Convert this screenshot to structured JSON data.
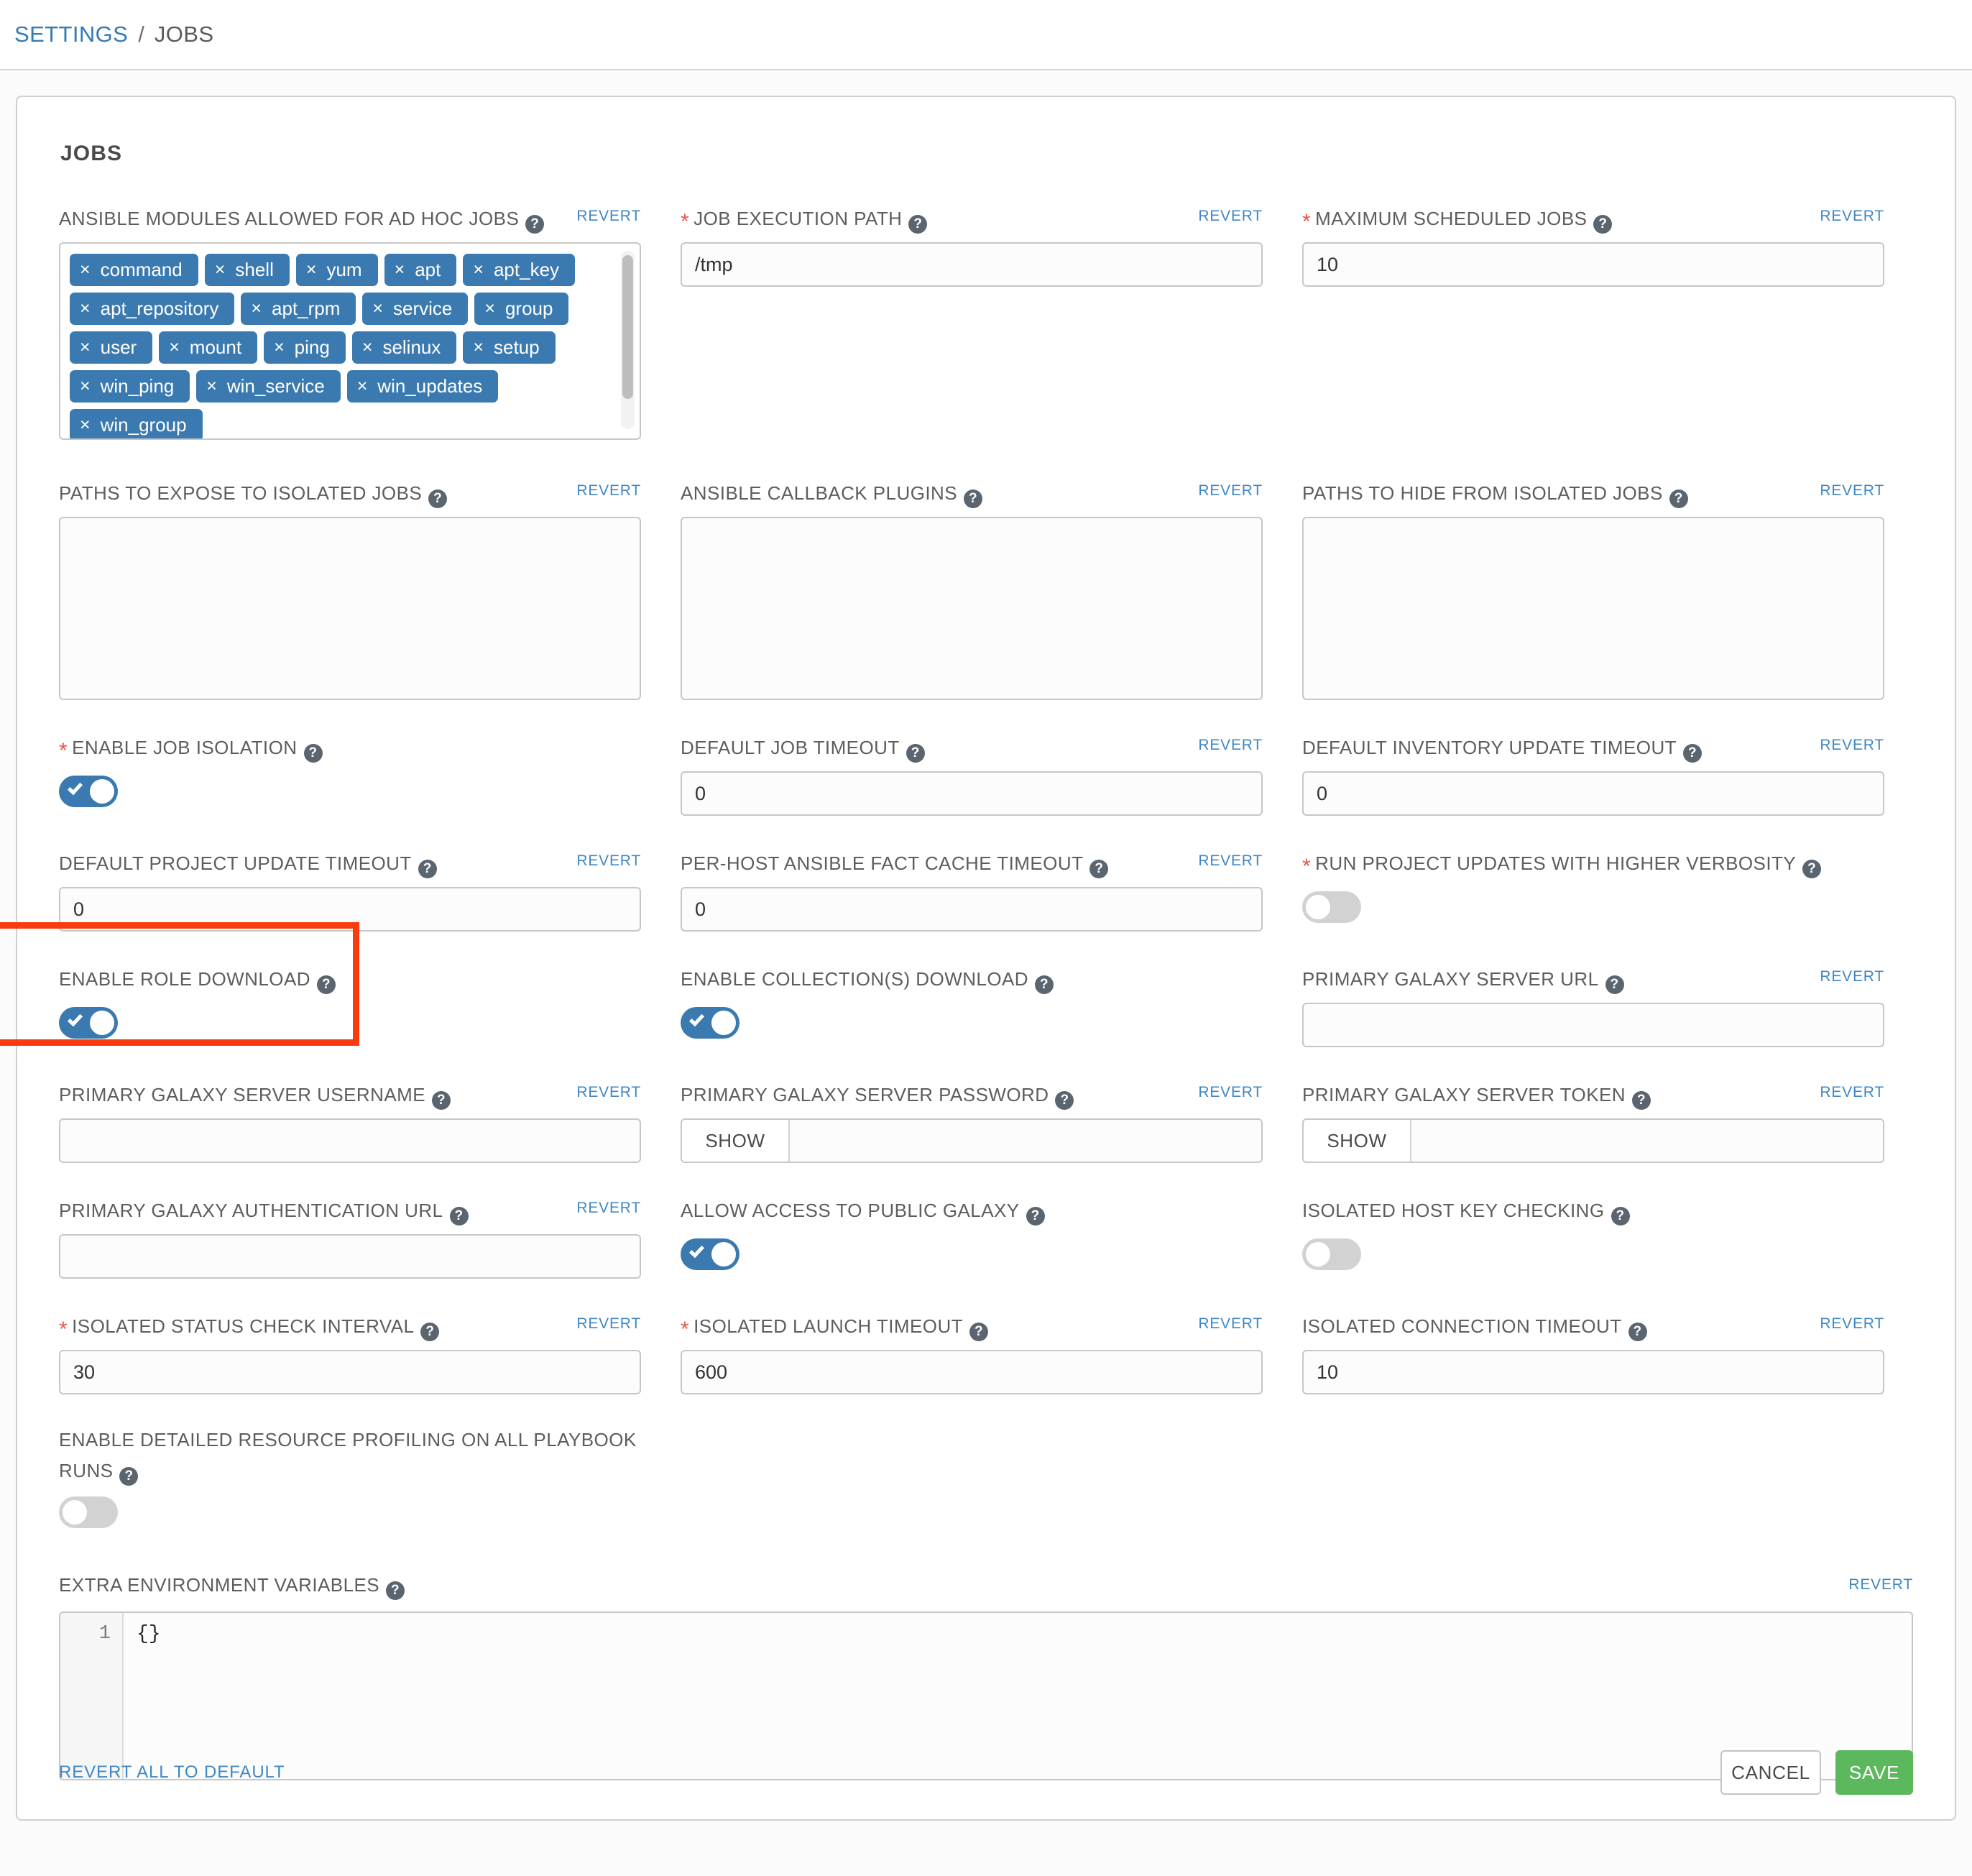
{
  "breadcrumb": {
    "parent": "SETTINGS",
    "separator": "/",
    "current": "JOBS"
  },
  "card": {
    "title": "JOBS"
  },
  "common": {
    "revert": "REVERT",
    "help": "?",
    "required_mark": "*",
    "show": "SHOW"
  },
  "fields": {
    "ansible_modules": {
      "label": "ANSIBLE MODULES ALLOWED FOR AD HOC JOBS",
      "revert": "REVERT",
      "tags": [
        "command",
        "shell",
        "yum",
        "apt",
        "apt_key",
        "apt_repository",
        "apt_rpm",
        "service",
        "group",
        "user",
        "mount",
        "ping",
        "selinux",
        "setup",
        "win_ping",
        "win_service",
        "win_updates",
        "win_group"
      ]
    },
    "job_execution_path": {
      "label": "JOB EXECUTION PATH",
      "revert": "REVERT",
      "value": "/tmp",
      "required": true
    },
    "maximum_scheduled_jobs": {
      "label": "MAXIMUM SCHEDULED JOBS",
      "revert": "REVERT",
      "value": "10",
      "required": true
    },
    "paths_expose": {
      "label": "PATHS TO EXPOSE TO ISOLATED JOBS",
      "revert": "REVERT",
      "value": ""
    },
    "callback_plugins": {
      "label": "ANSIBLE CALLBACK PLUGINS",
      "revert": "REVERT",
      "value": ""
    },
    "paths_hide": {
      "label": "PATHS TO HIDE FROM ISOLATED JOBS",
      "revert": "REVERT",
      "value": ""
    },
    "enable_job_isolation": {
      "label": "ENABLE JOB ISOLATION",
      "required": true,
      "state": "on"
    },
    "default_job_timeout": {
      "label": "DEFAULT JOB TIMEOUT",
      "revert": "REVERT",
      "value": "0"
    },
    "default_inventory_update_timeout": {
      "label": "DEFAULT INVENTORY UPDATE TIMEOUT",
      "revert": "REVERT",
      "value": "0"
    },
    "default_project_update_timeout": {
      "label": "DEFAULT PROJECT UPDATE TIMEOUT",
      "revert": "REVERT",
      "value": "0"
    },
    "per_host_fact_cache_timeout": {
      "label": "PER-HOST ANSIBLE FACT CACHE TIMEOUT",
      "revert": "REVERT",
      "value": "0"
    },
    "run_project_updates_verbosity": {
      "label": "RUN PROJECT UPDATES WITH HIGHER VERBOSITY",
      "required": true,
      "state": "off"
    },
    "enable_role_download": {
      "label": "ENABLE ROLE DOWNLOAD",
      "state": "on",
      "highlighted": true
    },
    "enable_collections_download": {
      "label": "ENABLE COLLECTION(S) DOWNLOAD",
      "state": "on"
    },
    "primary_galaxy_server_url": {
      "label": "PRIMARY GALAXY SERVER URL",
      "revert": "REVERT",
      "value": ""
    },
    "primary_galaxy_username": {
      "label": "PRIMARY GALAXY SERVER USERNAME",
      "revert": "REVERT",
      "value": ""
    },
    "primary_galaxy_password": {
      "label": "PRIMARY GALAXY SERVER PASSWORD",
      "revert": "REVERT",
      "value": "",
      "show": "SHOW"
    },
    "primary_galaxy_token": {
      "label": "PRIMARY GALAXY SERVER TOKEN",
      "revert": "REVERT",
      "value": "",
      "show": "SHOW"
    },
    "primary_galaxy_auth_url": {
      "label": "PRIMARY GALAXY AUTHENTICATION URL",
      "revert": "REVERT",
      "value": ""
    },
    "allow_public_galaxy": {
      "label": "ALLOW ACCESS TO PUBLIC GALAXY",
      "state": "on"
    },
    "isolated_host_key_checking": {
      "label": "ISOLATED HOST KEY CHECKING",
      "state": "off"
    },
    "isolated_status_check_interval": {
      "label": "ISOLATED STATUS CHECK INTERVAL",
      "revert": "REVERT",
      "value": "30",
      "required": true
    },
    "isolated_launch_timeout": {
      "label": "ISOLATED LAUNCH TIMEOUT",
      "revert": "REVERT",
      "value": "600",
      "required": true
    },
    "isolated_connection_timeout": {
      "label": "ISOLATED CONNECTION TIMEOUT",
      "revert": "REVERT",
      "value": "10"
    },
    "detailed_resource_profiling": {
      "label": "ENABLE DETAILED RESOURCE PROFILING ON ALL PLAYBOOK RUNS",
      "state": "off"
    },
    "extra_environment_variables": {
      "label": "EXTRA ENVIRONMENT VARIABLES",
      "revert": "REVERT",
      "line_number": "1",
      "value": "{}"
    }
  },
  "footer": {
    "revert_all": "REVERT ALL TO DEFAULT",
    "cancel": "CANCEL",
    "save": "SAVE"
  },
  "colors": {
    "accent_blue": "#3b7ab0",
    "link_blue": "#3f87c4",
    "save_green": "#5cb85c",
    "highlight_red": "#f93b10",
    "required_red": "#e8594a"
  }
}
